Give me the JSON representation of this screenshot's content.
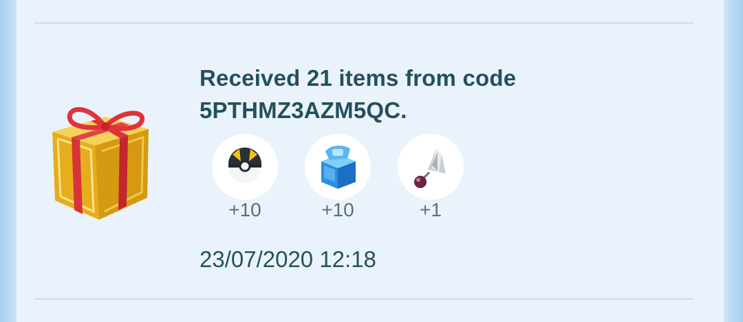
{
  "entry": {
    "title_line1": "Received 21 items from code",
    "title_line2": "5PTHMZ3AZM5QC.",
    "timestamp": "23/07/2020 12:18"
  },
  "rewards": [
    {
      "icon": "ultra-ball-icon",
      "count": "+10"
    },
    {
      "icon": "blue-crate-icon",
      "count": "+10"
    },
    {
      "icon": "crystal-shard-icon",
      "count": "+1"
    }
  ],
  "gift_icon": "gift-box-icon",
  "colors": {
    "text": "#24505c",
    "count_text": "#5c7077",
    "panel": "#eaf3fb",
    "divider": "#cfe3f3",
    "gift_gold": "#e8b422",
    "ribbon_red": "#d9333a"
  }
}
